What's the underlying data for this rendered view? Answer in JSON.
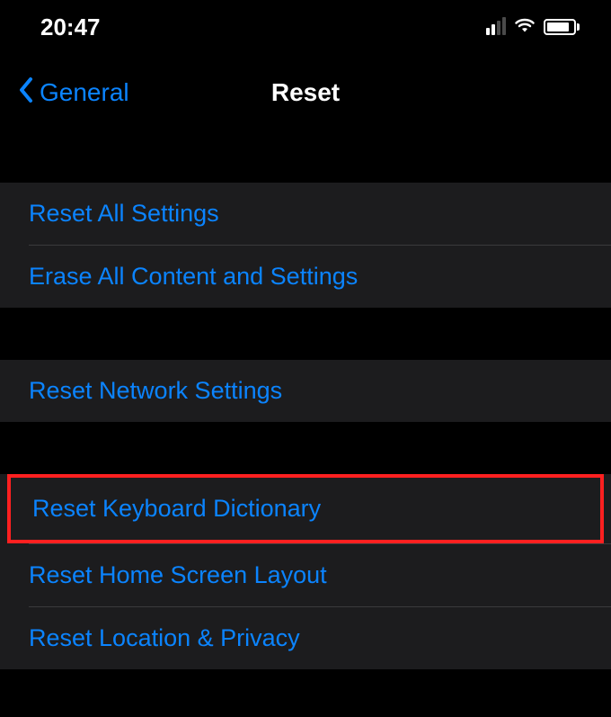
{
  "status": {
    "time": "20:47"
  },
  "nav": {
    "back_label": "General",
    "title": "Reset"
  },
  "sections": {
    "group1": {
      "row1": "Reset All Settings",
      "row2": "Erase All Content and Settings"
    },
    "group2": {
      "row1": "Reset Network Settings"
    },
    "group3": {
      "row1": "Reset Keyboard Dictionary",
      "row2": "Reset Home Screen Layout",
      "row3": "Reset Location & Privacy"
    }
  }
}
